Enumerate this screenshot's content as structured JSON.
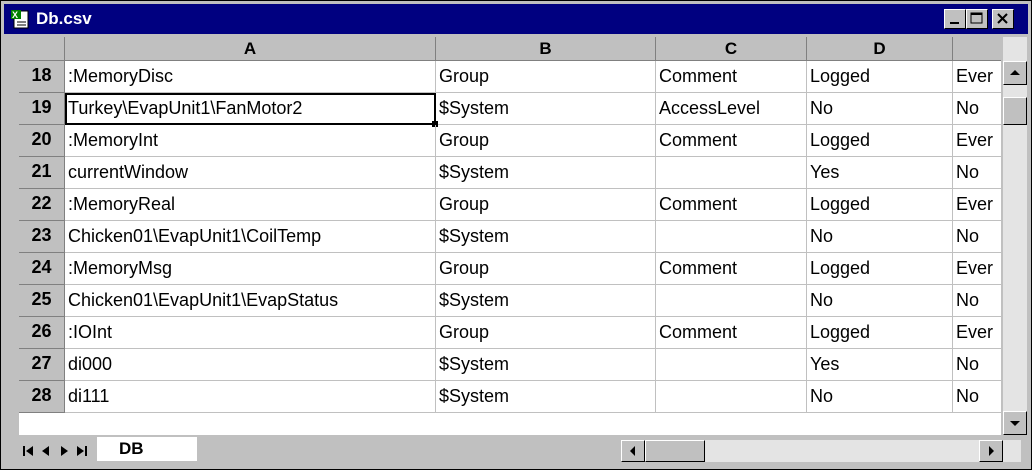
{
  "window": {
    "title": "Db.csv"
  },
  "columns": [
    "A",
    "B",
    "C",
    "D",
    ""
  ],
  "rows": [
    {
      "num": "18",
      "cells": [
        ":MemoryDisc",
        "Group",
        "Comment",
        "Logged",
        "Ever"
      ]
    },
    {
      "num": "19",
      "cells": [
        "Turkey\\EvapUnit1\\FanMotor2",
        "$System",
        "AccessLevel",
        "No",
        "No"
      ]
    },
    {
      "num": "20",
      "cells": [
        ":MemoryInt",
        "Group",
        "Comment",
        "Logged",
        "Ever"
      ]
    },
    {
      "num": "21",
      "cells": [
        "currentWindow",
        "$System",
        "",
        "Yes",
        "No"
      ]
    },
    {
      "num": "22",
      "cells": [
        ":MemoryReal",
        "Group",
        "Comment",
        "Logged",
        "Ever"
      ]
    },
    {
      "num": "23",
      "cells": [
        "Chicken01\\EvapUnit1\\CoilTemp",
        "$System",
        "",
        "No",
        "No"
      ]
    },
    {
      "num": "24",
      "cells": [
        ":MemoryMsg",
        "Group",
        "Comment",
        "Logged",
        "Ever"
      ]
    },
    {
      "num": "25",
      "cells": [
        "Chicken01\\EvapUnit1\\EvapStatus",
        "$System",
        "",
        "No",
        "No"
      ]
    },
    {
      "num": "26",
      "cells": [
        ":IOInt",
        "Group",
        "Comment",
        "Logged",
        "Ever"
      ]
    },
    {
      "num": "27",
      "cells": [
        "di000",
        "$System",
        "",
        "Yes",
        "No"
      ]
    },
    {
      "num": "28",
      "cells": [
        "di111",
        "$System",
        "",
        "No",
        "No"
      ]
    }
  ],
  "selection": {
    "row": "19",
    "column": "A"
  },
  "sheet_tab": {
    "label": "DB"
  },
  "icons": {
    "app": "excel-document-icon",
    "minimize": "minimize-icon",
    "maximize": "maximize-icon",
    "close": "close-icon",
    "first_sheet": "first-sheet-icon",
    "prev_sheet": "prev-sheet-icon",
    "next_sheet": "next-sheet-icon",
    "last_sheet": "last-sheet-icon",
    "scroll_up": "scroll-up-icon",
    "scroll_down": "scroll-down-icon",
    "scroll_left": "scroll-left-icon",
    "scroll_right": "scroll-right-icon"
  },
  "colors": {
    "titlebar": "#000080",
    "chrome": "#c0c0c0",
    "grid": "#c0c0c0",
    "cell_bg": "#ffffff"
  }
}
